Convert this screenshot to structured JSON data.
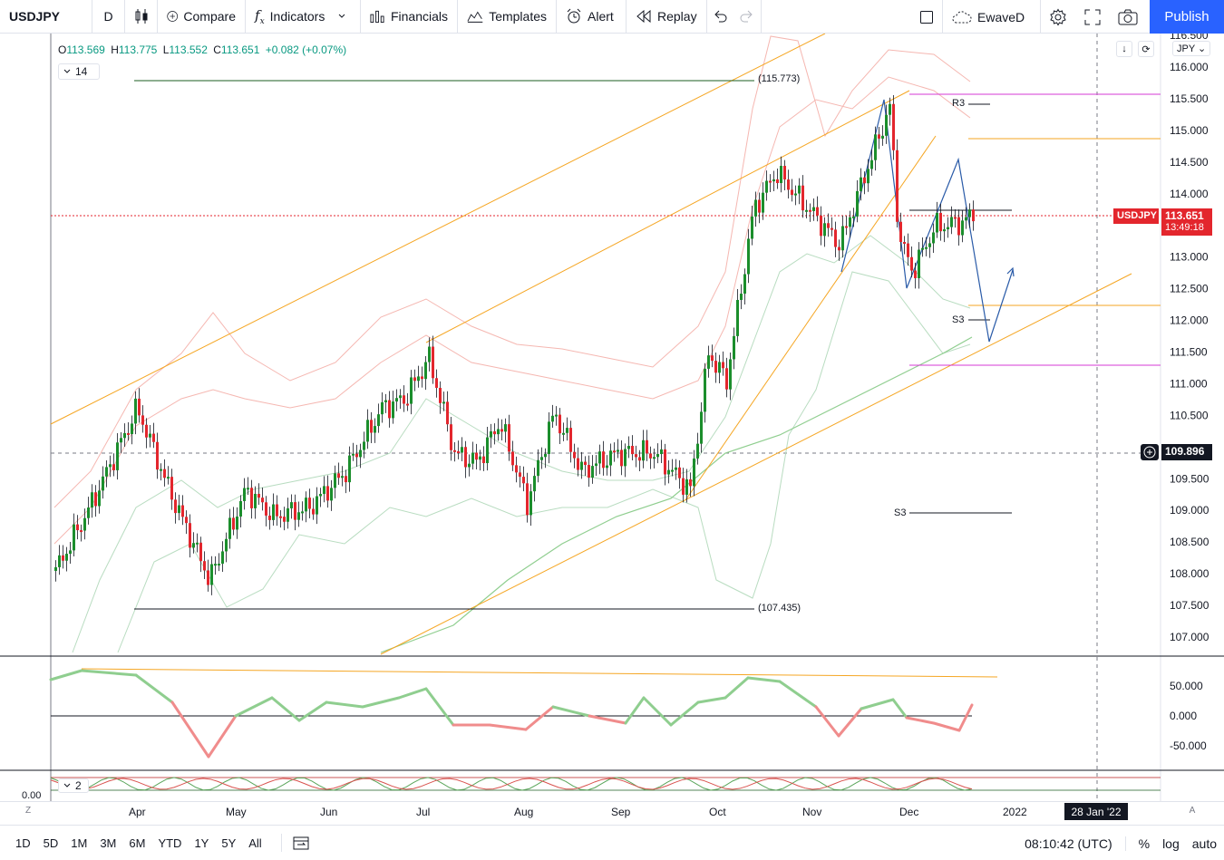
{
  "toolbar": {
    "symbol": "USDJPY",
    "interval": "D",
    "compare_label": "Compare",
    "indicators_label": "Indicators",
    "financials_label": "Financials",
    "templates_label": "Templates",
    "alert_label": "Alert",
    "replay_label": "Replay",
    "layout_name": "EwaveD",
    "publish_label": "Publish"
  },
  "legend": {
    "open_label": "O",
    "open": "113.569",
    "high_label": "H",
    "high": "113.775",
    "low_label": "L",
    "low": "113.552",
    "close_label": "C",
    "close": "113.651",
    "change": "+0.082 (+0.07%)",
    "indicator_count": "14",
    "pane2_count": "2"
  },
  "price_axis": {
    "currency": "JPY",
    "ticks": [
      "116.500",
      "116.000",
      "115.500",
      "115.000",
      "114.500",
      "114.000",
      "113.000",
      "112.500",
      "112.000",
      "111.500",
      "111.000",
      "110.500",
      "109.500",
      "109.000",
      "108.500",
      "108.000",
      "107.500",
      "107.000"
    ],
    "last_symbol": "USDJPY",
    "last_price": "113.651",
    "countdown": "13:49:18",
    "crosshair_price": "109.896"
  },
  "osc_axis": {
    "ticks": [
      "50.000",
      "0.000",
      "-50.000"
    ],
    "pane3_tick": "0.00"
  },
  "annotations": {
    "high_level": "(115.773)",
    "low_level": "(107.435)",
    "r3": "R3",
    "s3_upper": "S3",
    "s3_lower": "S3"
  },
  "time_axis": {
    "months": [
      "Apr",
      "May",
      "Jun",
      "Jul",
      "Aug",
      "Sep",
      "Oct",
      "Nov",
      "Dec",
      "2022"
    ],
    "crosshair_date": "28 Jan '22",
    "left_btn": "Z",
    "right_btn": "A"
  },
  "bottom_bar": {
    "ranges": [
      "1D",
      "5D",
      "1M",
      "3M",
      "6M",
      "YTD",
      "1Y",
      "5Y",
      "All"
    ],
    "clock": "08:10:42 (UTC)",
    "percent": "%",
    "log": "log",
    "auto": "auto"
  },
  "colors": {
    "up": "#1b8e2c",
    "down": "#e3262d",
    "accent": "#2962ff",
    "channel": "#f5a623"
  }
}
